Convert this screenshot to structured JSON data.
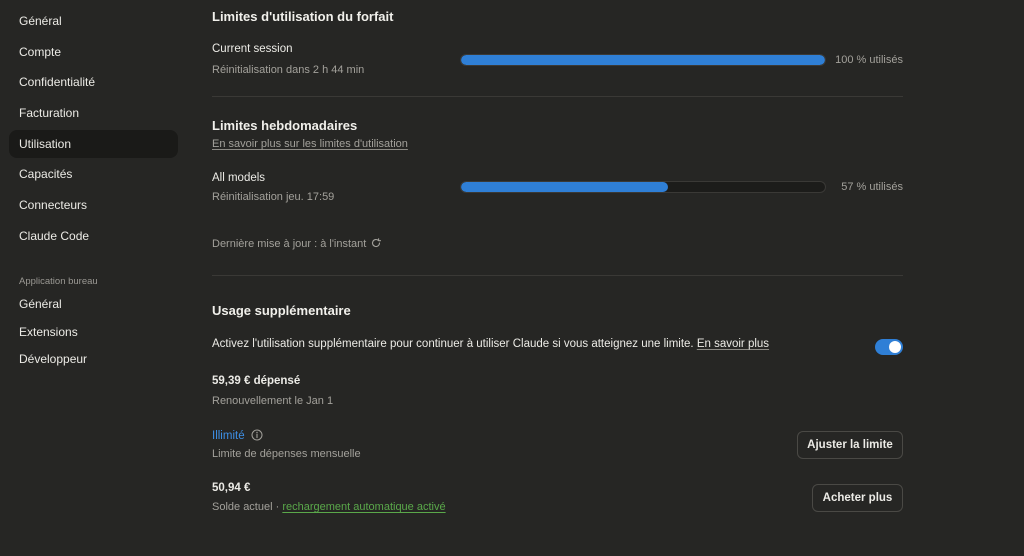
{
  "sidebar": {
    "items": [
      {
        "label": "Général"
      },
      {
        "label": "Compte"
      },
      {
        "label": "Confidentialité"
      },
      {
        "label": "Facturation"
      },
      {
        "label": "Utilisation"
      },
      {
        "label": "Capacités"
      },
      {
        "label": "Connecteurs"
      },
      {
        "label": "Claude Code"
      }
    ],
    "desktop_section_title": "Application bureau",
    "desktop_items": [
      {
        "label": "Général"
      },
      {
        "label": "Extensions"
      },
      {
        "label": "Développeur"
      }
    ]
  },
  "plan_limits": {
    "title": "Limites d'utilisation du forfait",
    "session_label": "Current session",
    "session_reset": "Réinitialisation dans 2 h 44 min",
    "session_percent": 100,
    "session_percent_text": "100 % utilisés"
  },
  "weekly_limits": {
    "title": "Limites hebdomadaires",
    "learn_more": "En savoir plus sur les limites d'utilisation",
    "models_label": "All models",
    "models_reset": "Réinitialisation jeu. 17:59",
    "models_percent": 57,
    "models_percent_text": "57 % utilisés",
    "last_update": "Dernière mise à jour : à l'instant"
  },
  "extra_usage": {
    "title": "Usage supplémentaire",
    "description": "Activez l'utilisation supplémentaire pour continuer à utiliser Claude si vous atteignez une limite.",
    "description_link": "En savoir plus",
    "toggle_on": true,
    "spent": "59,39 € dépensé",
    "renewal": "Renouvellement le Jan 1",
    "limit_value": "Illimité",
    "limit_label": "Limite de dépenses mensuelle",
    "adjust_button": "Ajuster la limite",
    "balance_value": "50,94 €",
    "balance_label": "Solde actuel · ",
    "balance_link": "rechargement automatique activé",
    "buy_button": "Acheter plus"
  },
  "colors": {
    "accent": "#2f7fd6",
    "link_green": "#5aa84a",
    "background": "#262624"
  }
}
